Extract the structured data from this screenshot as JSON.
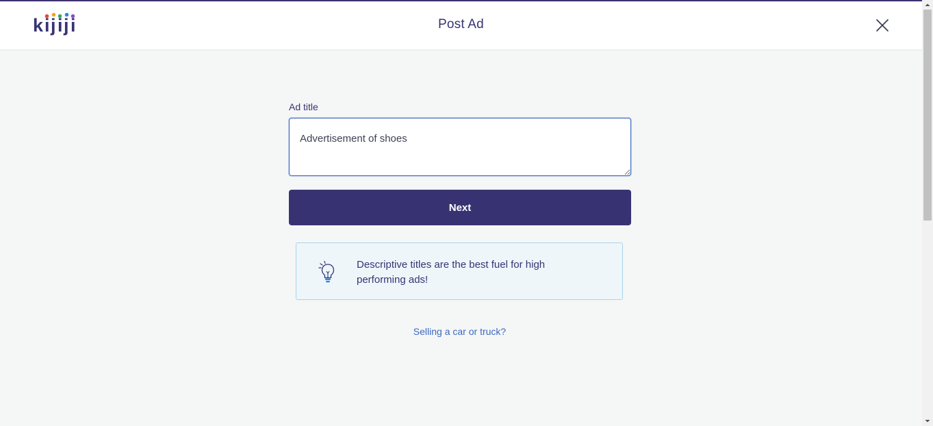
{
  "header": {
    "logo_text": "kijiji",
    "title": "Post Ad",
    "close_icon": "close-icon"
  },
  "form": {
    "title_label": "Ad title",
    "title_value": "Advertisement of shoes",
    "next_label": "Next"
  },
  "tip": {
    "icon": "lightbulb-icon",
    "text": "Descriptive titles are the best fuel for high performing ads!"
  },
  "links": {
    "car_link": "Selling a car or truck?"
  },
  "colors": {
    "brand_purple": "#373373",
    "accent_blue": "#3b69c3",
    "tip_bg": "#eef6fa",
    "tip_border": "#a9d4ea",
    "page_bg": "#f5f6f6"
  }
}
